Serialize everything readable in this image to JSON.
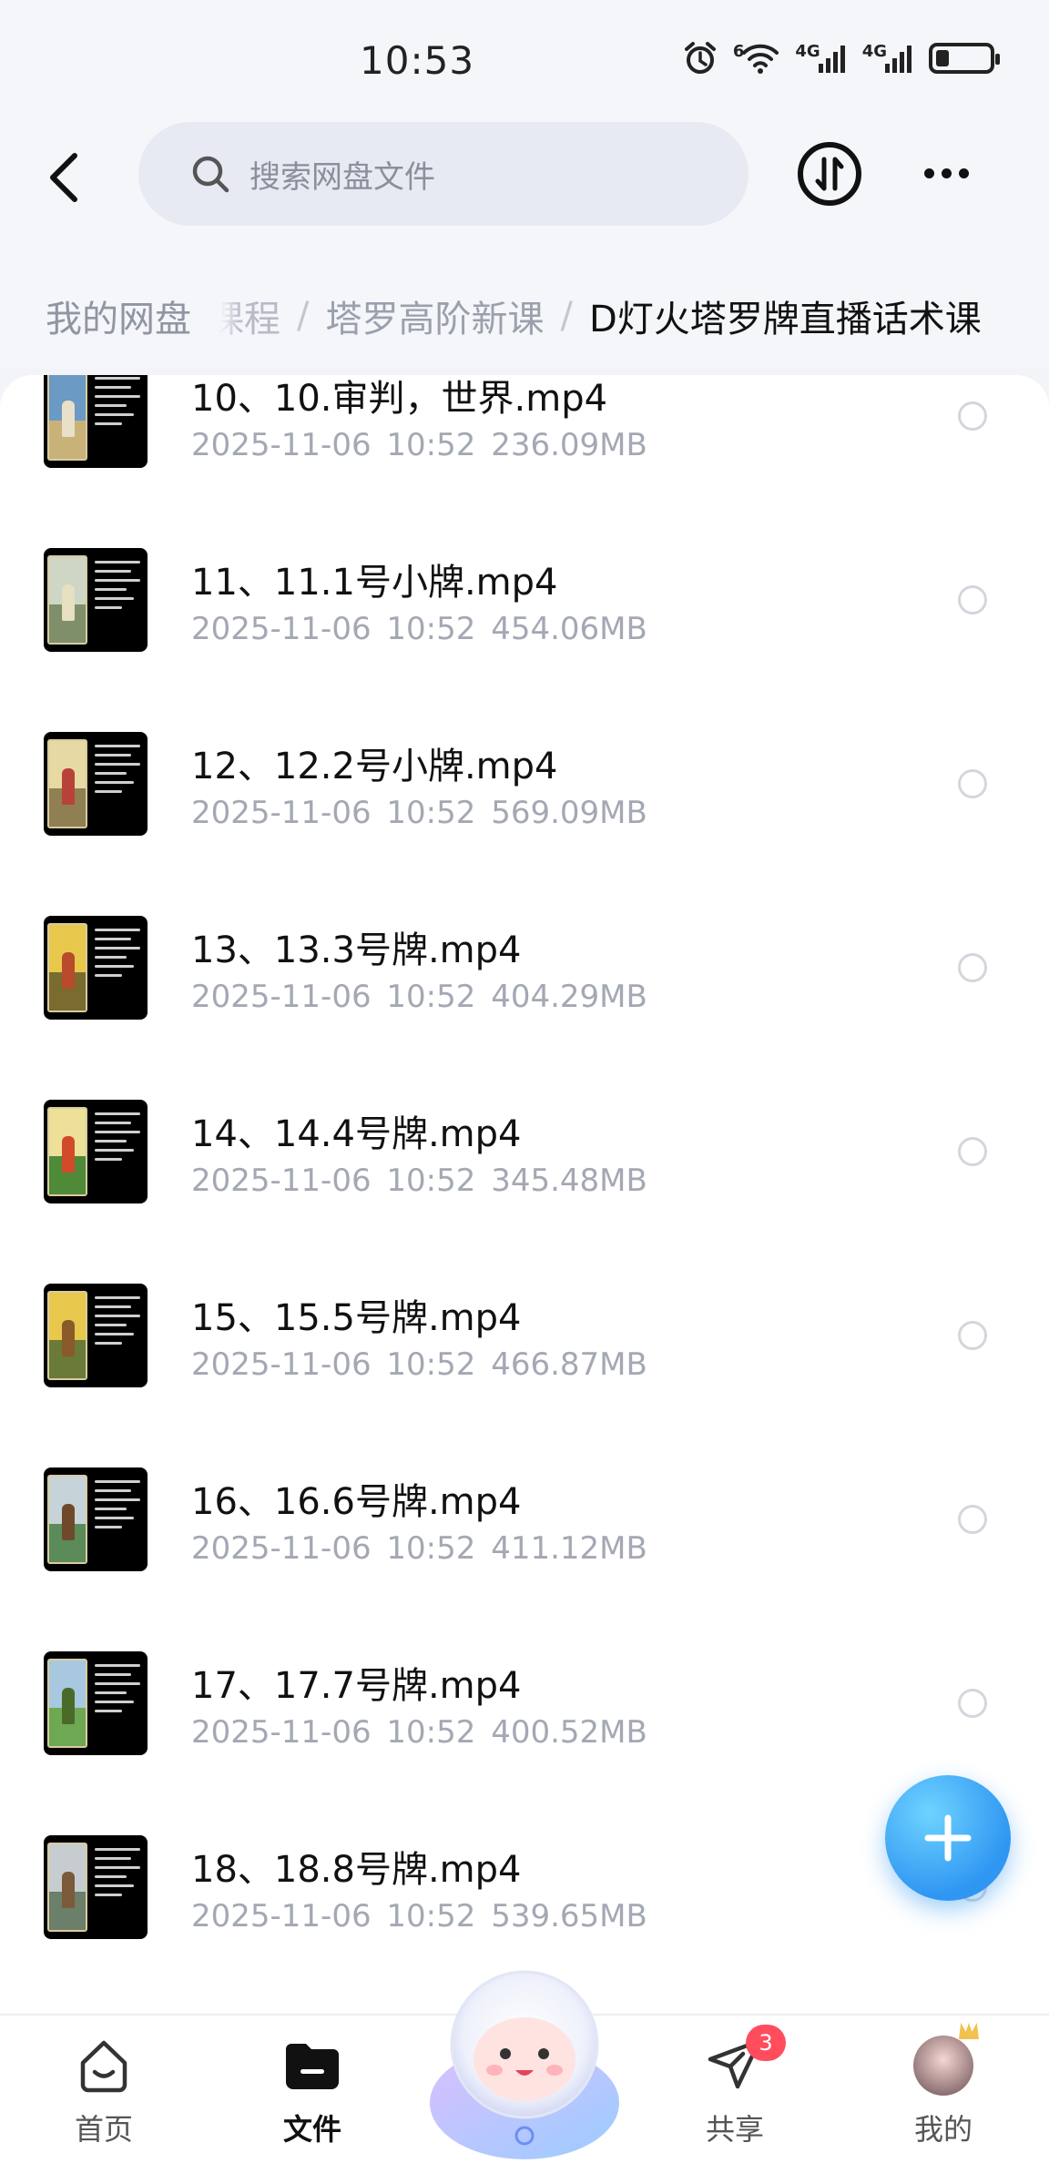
{
  "status_bar": {
    "time": "10:53",
    "icons": [
      "alarm-icon",
      "wifi-icon",
      "4g-signal-icon",
      "4g-signal-icon",
      "battery-icon"
    ],
    "network_labels": [
      "6",
      "4G",
      "4G"
    ],
    "battery_level": 0.2
  },
  "header": {
    "search_placeholder": "搜索网盘文件",
    "icons": [
      "back-icon",
      "search-icon",
      "transfer-icon",
      "more-icon"
    ]
  },
  "breadcrumb": {
    "root": "我的网盘",
    "partial": "课程",
    "separator": "/",
    "items": [
      "塔罗高阶新课",
      "D灯火塔罗牌直播话术课"
    ]
  },
  "files": [
    {
      "name": "10、10.审判，世界.mp4",
      "date": "2025-11-06",
      "time": "10:52",
      "size": "236.09MB"
    },
    {
      "name": "11、11.1号小牌.mp4",
      "date": "2025-11-06",
      "time": "10:52",
      "size": "454.06MB"
    },
    {
      "name": "12、12.2号小牌.mp4",
      "date": "2025-11-06",
      "time": "10:52",
      "size": "569.09MB"
    },
    {
      "name": "13、13.3号牌.mp4",
      "date": "2025-11-06",
      "time": "10:52",
      "size": "404.29MB"
    },
    {
      "name": "14、14.4号牌.mp4",
      "date": "2025-11-06",
      "time": "10:52",
      "size": "345.48MB"
    },
    {
      "name": "15、15.5号牌.mp4",
      "date": "2025-11-06",
      "time": "10:52",
      "size": "466.87MB"
    },
    {
      "name": "16、16.6号牌.mp4",
      "date": "2025-11-06",
      "time": "10:52",
      "size": "411.12MB"
    },
    {
      "name": "17、17.7号牌.mp4",
      "date": "2025-11-06",
      "time": "10:52",
      "size": "400.52MB"
    },
    {
      "name": "18、18.8号牌.mp4",
      "date": "2025-11-06",
      "time": "10:52",
      "size": "539.65MB"
    }
  ],
  "fab": {
    "icon": "plus-icon"
  },
  "bottom_nav": {
    "items": [
      {
        "label": "首页",
        "icon": "home-icon"
      },
      {
        "label": "文件",
        "icon": "folder-icon",
        "active": true
      },
      {
        "label": "共享",
        "icon": "send-icon",
        "badge": "3"
      },
      {
        "label": "我的",
        "icon": "avatar"
      }
    ],
    "center_icon": "mascot-icon"
  },
  "colors": {
    "background": "#f2f4f8",
    "accent": "#2f96f2",
    "badge": "#ff4d5e",
    "meta_text": "#a3a8b3"
  }
}
